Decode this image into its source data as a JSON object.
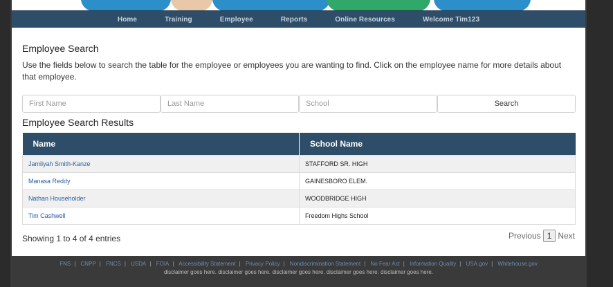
{
  "nav": {
    "items": [
      "Home",
      "Training",
      "Employee",
      "Reports",
      "Online Resources",
      "Welcome Tim123"
    ]
  },
  "page": {
    "title": "Employee Search",
    "description": "Use the fields below to search the table for the employee or employees you are wanting to find. Click on the employee name for more details about that employee."
  },
  "search": {
    "first_name_placeholder": "First Name",
    "last_name_placeholder": "Last Name",
    "school_placeholder": "School",
    "button_label": "Search"
  },
  "results": {
    "title": "Employee Search Results",
    "columns": [
      "Name",
      "School Name"
    ],
    "rows": [
      {
        "name": "Jamilyah Smith-Kanze",
        "school": "STAFFORD SR. HIGH"
      },
      {
        "name": "Manasa Reddy",
        "school": "GAINESBORO ELEM."
      },
      {
        "name": "Nathan Householder",
        "school": "WOODBRIDGE HIGH"
      },
      {
        "name": "Tim Cashwell",
        "school": "Freedom Highs School"
      }
    ],
    "showing": "Showing 1 to 4 of 4 entries"
  },
  "pager": {
    "previous": "Previous",
    "current": "1",
    "next": "Next"
  },
  "footer": {
    "links": [
      "FNS",
      "CNPP",
      "FNCS",
      "USDA",
      "FOIA",
      "Accessibility Statement",
      "Privacy Policy",
      "Nondiscrimination Statement",
      "No Fear Act",
      "Information Quality",
      "USA.gov",
      "Whitehouse.gov"
    ],
    "disclaimer": "disclaimer goes here. disclaimer goes here. disclaimer goes here. disclaimer goes here. disclaimer goes here.",
    "link_color": "#6b8db5"
  },
  "colors": {
    "nav_bg": "#2e4d69",
    "header_bg": "#2e4d69",
    "link": "#2a5d9f"
  }
}
